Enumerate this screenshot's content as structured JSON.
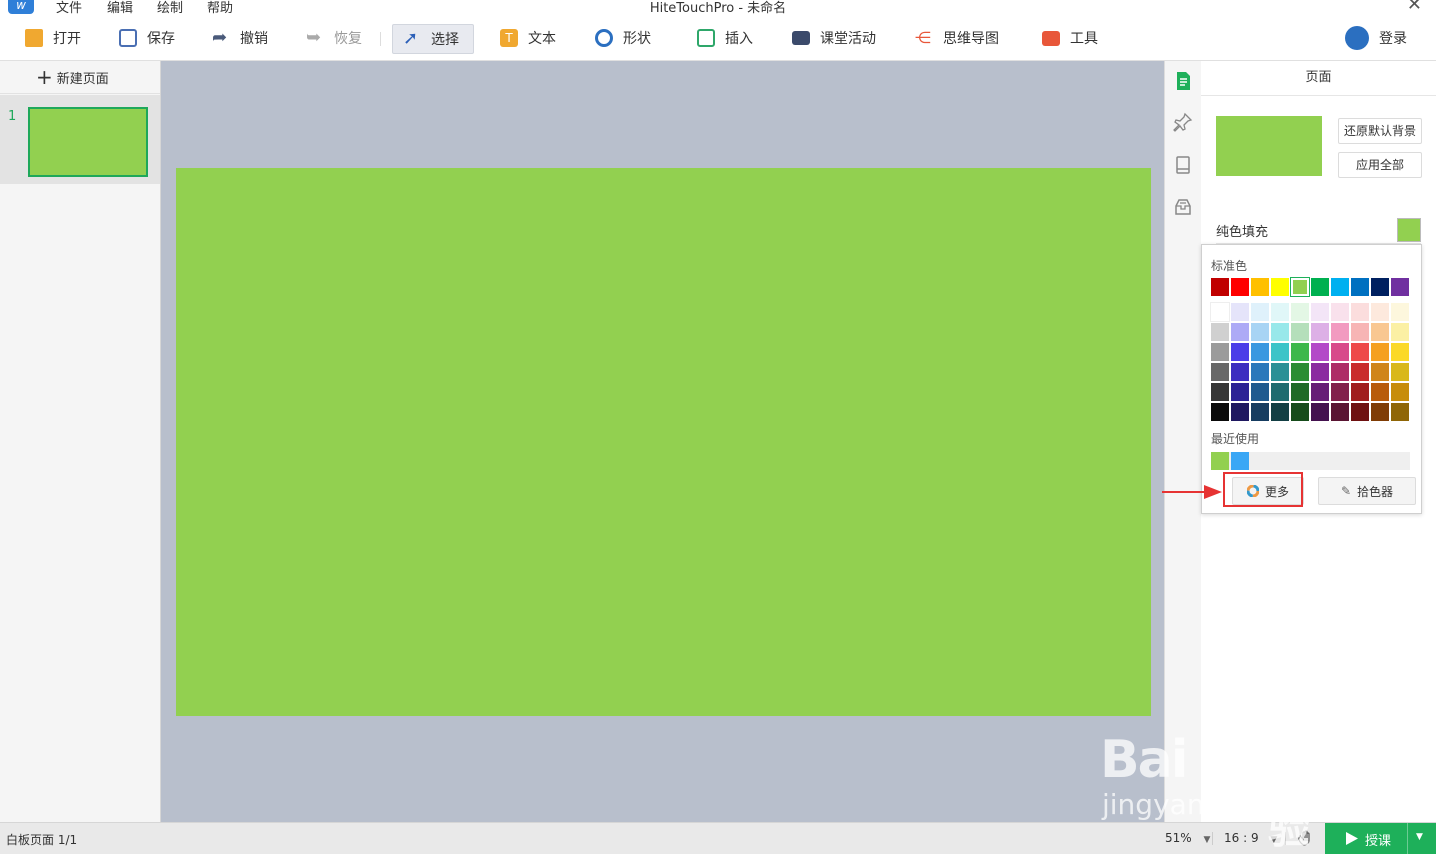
{
  "window": {
    "title": "HiteTouchPro - 未命名",
    "menu": [
      "文件",
      "编辑",
      "绘制",
      "帮助"
    ],
    "close_glyph": "✕"
  },
  "toolbar": {
    "open": "打开",
    "save": "保存",
    "undo": "撤销",
    "redo": "恢复",
    "select": "选择",
    "text": "文本",
    "shape": "形状",
    "insert": "插入",
    "class_activity": "课堂活动",
    "mind_map": "思维导图",
    "tools": "工具",
    "login": "登录"
  },
  "left_panel": {
    "new_page": "新建页面",
    "thumb_number": "1"
  },
  "right_panel": {
    "title": "页面",
    "restore_default_bg": "还原默认背景",
    "apply_all": "应用全部",
    "solid_fill": "纯色填充"
  },
  "color_popup": {
    "standard_colors_label": "标准色",
    "recent_label": "最近使用",
    "more_button": "更多",
    "picker_button": "拾色器",
    "standard_colors": [
      "#c00000",
      "#ff0000",
      "#ffc000",
      "#ffff00",
      "#92d050",
      "#00b050",
      "#00b0f0",
      "#0070c0",
      "#002060",
      "#7030a0"
    ],
    "selected_standard_index": 4,
    "shade_grid": [
      [
        "#ffffff",
        "#e5e4fa",
        "#dff1fb",
        "#e0f7f8",
        "#e3f7e5",
        "#f3e5f7",
        "#f9e1ec",
        "#fbdddd",
        "#fde9dd",
        "#fdf7dd"
      ],
      [
        "#d0d0d0",
        "#adaaf6",
        "#a8d4f4",
        "#98e8ea",
        "#b5dfbb",
        "#ddb0e6",
        "#f29ac0",
        "#f7b5b5",
        "#f9c791",
        "#fbf0a4"
      ],
      [
        "#9b9b9b",
        "#4b3de8",
        "#3a98e0",
        "#3cc4c8",
        "#3db84b",
        "#b34ac8",
        "#d84a8a",
        "#ee4949",
        "#f5a020",
        "#fbd927"
      ],
      [
        "#686868",
        "#3c2ec0",
        "#2b78bb",
        "#2a9096",
        "#2b8d33",
        "#8b2ba0",
        "#ae2c66",
        "#c92c2c",
        "#d0851a",
        "#d9b81a"
      ],
      [
        "#363636",
        "#2c2295",
        "#1f5a8f",
        "#1e6b6f",
        "#1f6a26",
        "#661e76",
        "#82204b",
        "#a01d1d",
        "#b85b0a",
        "#c78d0a"
      ],
      [
        "#0a0a0a",
        "#1f1860",
        "#163c60",
        "#133f44",
        "#164b1b",
        "#44124f",
        "#5a1533",
        "#6e1111",
        "#7f3c05",
        "#8f6606"
      ]
    ],
    "recent_colors": [
      "#92d050",
      "#3aa7f5"
    ]
  },
  "status_bar": {
    "page_info": "白板页面 1/1",
    "zoom": "51%",
    "ratio": "16 : 9",
    "start_lesson": "授课"
  },
  "watermark": {
    "brand": "Bai",
    "brand_cn": "经验",
    "url": "jingyan.baidu.com"
  },
  "colors": {
    "slide_background": "#92d050",
    "canvas_area": "#b8bfcc",
    "accent_green": "#1eb05a",
    "highlight_red": "#e63333"
  }
}
